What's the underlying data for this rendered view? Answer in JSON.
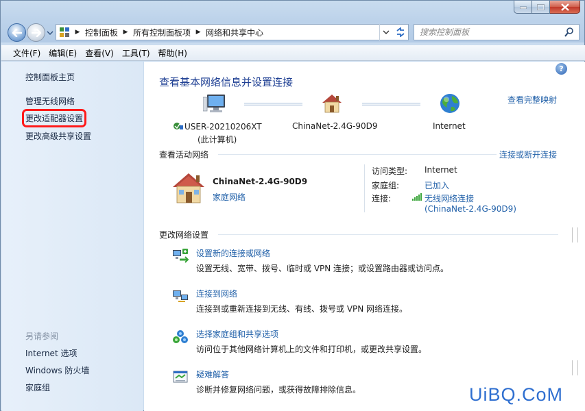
{
  "window": {
    "caption_buttons": [
      "minimize-icon",
      "maximize-icon",
      "close-icon"
    ]
  },
  "address": {
    "segments": [
      "控制面板",
      "所有控制面板项",
      "网络和共享中心"
    ],
    "search_placeholder": "搜索控制面板"
  },
  "menu": [
    "文件(F)",
    "编辑(E)",
    "查看(V)",
    "工具(T)",
    "帮助(H)"
  ],
  "sidebar": {
    "home": "控制面板主页",
    "items": [
      "管理无线网络",
      "更改适配器设置",
      "更改高级共享设置"
    ],
    "highlighted_index": 1,
    "see_also_title": "另请参阅",
    "see_also": [
      "Internet 选项",
      "Windows 防火墙",
      "家庭组"
    ]
  },
  "main": {
    "title": "查看基本网络信息并设置连接",
    "view_full_map": "查看完整映射",
    "map": {
      "computer_name": "USER-20210206XT",
      "computer_sub": "(此计算机)",
      "network_name": "ChinaNet-2.4G-90D9",
      "internet": "Internet"
    },
    "active_title": "查看活动网络",
    "connect_disconnect": "连接或断开连接",
    "active": {
      "name": "ChinaNet-2.4G-90D9",
      "kind": "家庭网络",
      "access_label": "访问类型:",
      "access_value": "Internet",
      "homegroup_label": "家庭组:",
      "homegroup_value": "已加入",
      "connection_label": "连接:",
      "connection_value": "无线网络连接",
      "connection_ssid": "(ChinaNet-2.4G-90D9)"
    },
    "change_title": "更改网络设置",
    "tasks": [
      {
        "link": "设置新的连接或网络",
        "desc": "设置无线、宽带、拨号、临时或 VPN 连接；或设置路由器或访问点。"
      },
      {
        "link": "连接到网络",
        "desc": "连接到或重新连接到无线、有线、拨号或 VPN 网络连接。"
      },
      {
        "link": "选择家庭组和共享选项",
        "desc": "访问位于其他网络计算机上的文件和打印机，或更改共享设置。"
      },
      {
        "link": "疑难解答",
        "desc": "诊断并修复网络问题，或获得故障排除信息。"
      }
    ]
  },
  "watermark": "UiBQ.CoM",
  "colors": {
    "link": "#1f5fa8",
    "title": "#1e3f93",
    "highlight": "#ff1a1a"
  }
}
